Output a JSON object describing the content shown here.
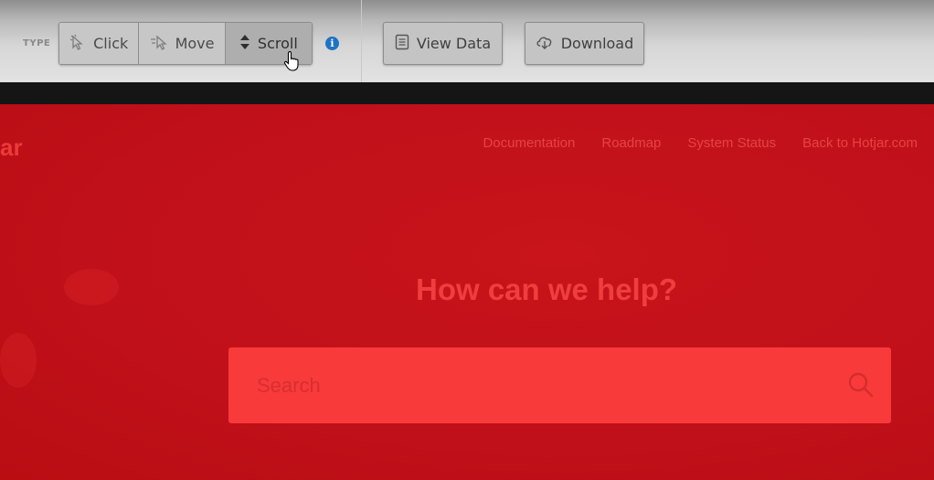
{
  "toolbar": {
    "type_label": "TYPE",
    "modes": [
      {
        "label": "Click",
        "icon": "click-icon",
        "active": false
      },
      {
        "label": "Move",
        "icon": "move-icon",
        "active": false
      },
      {
        "label": "Scroll",
        "icon": "scroll-icon",
        "active": true
      }
    ],
    "info_icon": "info-icon",
    "info_glyph": "i",
    "view_data_label": "View Data",
    "download_label": "Download"
  },
  "page": {
    "logo_fragment": "ar",
    "nav": [
      "Documentation",
      "Roadmap",
      "System Status",
      "Back to Hotjar.com"
    ],
    "headline": "How can we help?",
    "search_placeholder": "Search"
  },
  "colors": {
    "overlay_red": "#c20f14",
    "search_red": "#f93a3a",
    "info_blue": "#1f73c4"
  }
}
